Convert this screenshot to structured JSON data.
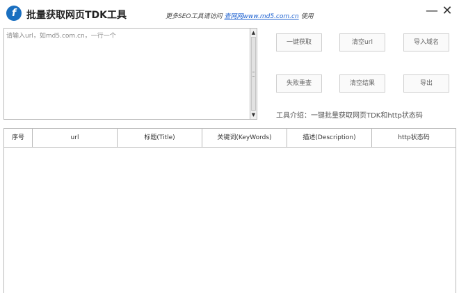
{
  "app": {
    "title": "批量获取网页TDK工具",
    "promo_prefix": "更多SEO工具请访问",
    "promo_link": "查网网www.md5.com.cn",
    "promo_suffix": "使用",
    "minimize_glyph": "—",
    "close_glyph": "✕"
  },
  "input": {
    "placeholder": "请输入url，如md5.com.cn，一行一个",
    "value": ""
  },
  "buttons": {
    "fetch": "一键获取",
    "clear_url": "清空url",
    "import_domain": "导入域名",
    "retry_failed": "失败重查",
    "clear_results": "清空结果",
    "export": "导出"
  },
  "intro": "工具介绍：一键批量获取网页TDK和http状态码",
  "table": {
    "columns": [
      "序号",
      "url",
      "标题(Title)",
      "关键词(KeyWords)",
      "描述(Description)",
      "http状态码"
    ],
    "rows": []
  },
  "icons": {
    "logo": "app-logo-icon",
    "minimize": "minimize-icon",
    "close": "close-icon"
  },
  "colors": {
    "link": "#1a5fd0",
    "logo": "#1a6fc0",
    "border": "#b9b9b9"
  }
}
